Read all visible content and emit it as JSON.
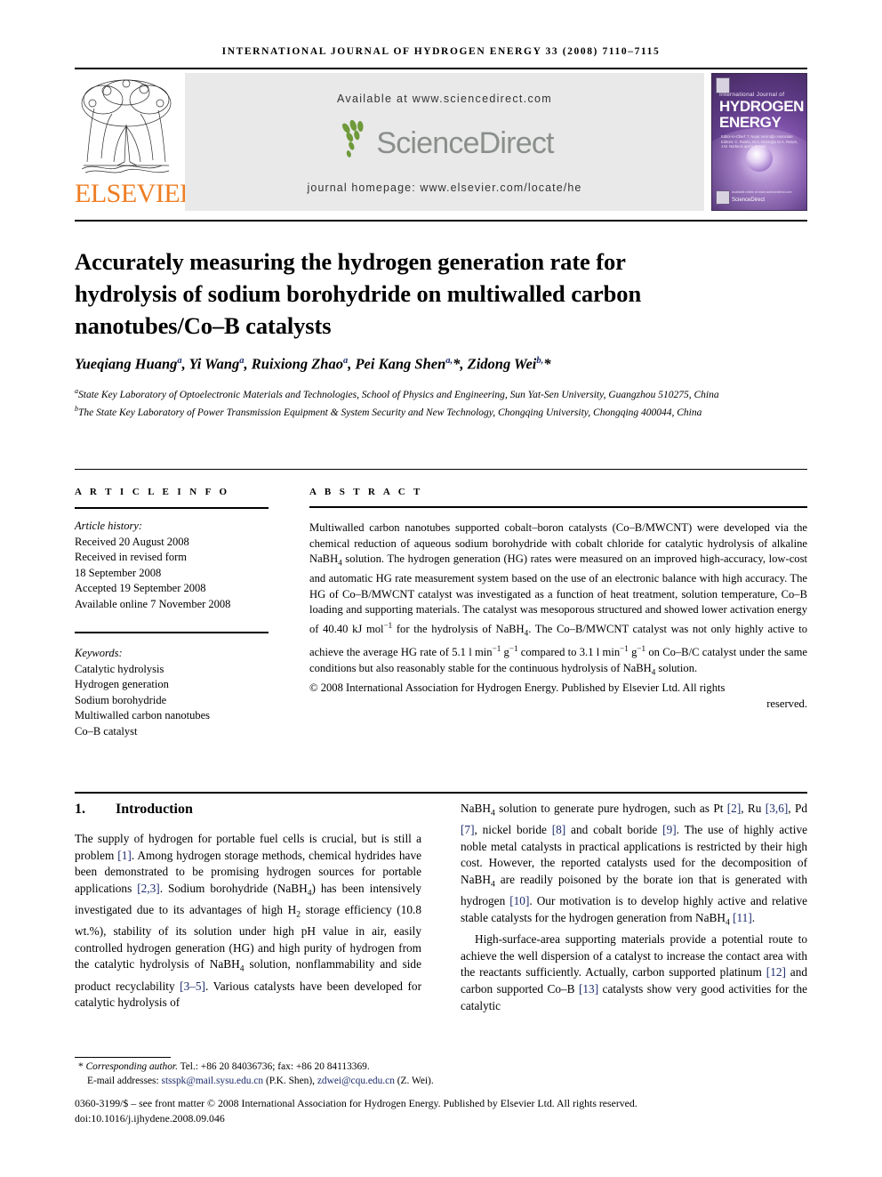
{
  "running_head": "INTERNATIONAL JOURNAL OF HYDROGEN ENERGY 33 (2008) 7110–7115",
  "masthead": {
    "publisher": "ELSEVIER",
    "available_at": "Available at www.sciencedirect.com",
    "sciencedirect_word": "ScienceDirect",
    "journal_homepage": "journal homepage: www.elsevier.com/locate/he",
    "cover": {
      "line1": "International Journal of",
      "line2": "HYDROGEN",
      "line3": "ENERGY",
      "editors": "Editor-in-Chief: T. Nejat Veziroğlu\nAssociate Editors: C. Rosén, M.A. Veziroğlu\nM.A. Rosen, J.M. Norbeck\nand E.E. Unit",
      "sciencedirect_badge": "ScienceDirect",
      "sciencedirect_badge_sup": "Available online at www.sciencedirect.com"
    }
  },
  "title": "Accurately measuring the hydrogen generation rate for hydrolysis of sodium borohydride on multiwalled carbon nanotubes/Co–B catalysts",
  "authors_html": "Yueqiang Huang<sup>a</sup>, Yi Wang<sup>a</sup>, Ruixiong Zhao<sup>a</sup>, Pei Kang Shen<sup>a,</sup>*, Zidong Wei<sup>b,</sup>*",
  "affiliations_html": "<sup>a</sup>State Key Laboratory of Optoelectronic Materials and Technologies, School of Physics and Engineering, Sun Yat-Sen University, Guangzhou 510275, China<br><sup>b</sup>The State Key Laboratory of Power Transmission Equipment &amp; System Security and New Technology, Chongqing University, Chongqing 400044, China",
  "article_info": {
    "heading": "A R T I C L E   I N F O",
    "history_label": "Article history:",
    "history": [
      "Received 20 August 2008",
      "Received in revised form",
      "18 September 2008",
      "Accepted 19 September 2008",
      "Available online 7 November 2008"
    ],
    "keywords_label": "Keywords:",
    "keywords": [
      "Catalytic hydrolysis",
      "Hydrogen generation",
      "Sodium borohydride",
      "Multiwalled carbon nanotubes",
      "Co–B catalyst"
    ]
  },
  "abstract": {
    "heading": "A B S T R A C T",
    "body_html": "Multiwalled carbon nanotubes supported cobalt–boron catalysts (Co–B/MWCNT) were developed via the chemical reduction of aqueous sodium borohydride with cobalt chloride for catalytic hydrolysis of alkaline NaBH<sub>4</sub> solution. The hydrogen generation (HG) rates were measured on an improved high-accuracy, low-cost and automatic HG rate measurement system based on the use of an electronic balance with high accuracy. The HG of Co–B/MWCNT catalyst was investigated as a function of heat treatment, solution temperature, Co–B loading and supporting materials. The catalyst was mesoporous structured and showed lower activation energy of 40.40 kJ mol<sup>−1</sup> for the hydrolysis of NaBH<sub>4</sub>. The Co–B/MWCNT catalyst was not only highly active to achieve the average HG rate of 5.1 l min<sup>−1</sup> g<sup>−1</sup> compared to 3.1 l min<sup>−1</sup> g<sup>−1</sup> on Co–B/C catalyst under the same conditions but also reasonably stable for the continuous hydrolysis of NaBH<sub>4</sub> solution.",
    "copyright_html": "© 2008 International Association for Hydrogen Energy. Published by Elsevier Ltd. All rights<span class=\"right-end\">reserved.</span>"
  },
  "introduction": {
    "number": "1.",
    "heading": "Introduction",
    "left_paragraphs_html": [
      "The supply of hydrogen for portable fuel cells is crucial, but is still a problem <span class=\"ref\">[1]</span>. Among hydrogen storage methods, chemical hydrides have been demonstrated to be promising hydrogen sources for portable applications <span class=\"ref\">[2,3]</span>. Sodium borohydride (NaBH<sub>4</sub>) has been intensively investigated due to its advantages of high H<sub>2</sub> storage efficiency (10.8 wt.%), stability of its solution under high pH value in air, easily controlled hydrogen generation (HG) and high purity of hydrogen from the catalytic hydrolysis of NaBH<sub>4</sub> solution, nonflammability and side product recyclability <span class=\"ref\">[3–5]</span>. Various catalysts have been developed for catalytic hydrolysis of"
    ],
    "right_paragraphs_html": [
      "NaBH<sub>4</sub> solution to generate pure hydrogen, such as Pt <span class=\"ref\">[2]</span>, Ru <span class=\"ref\">[3,6]</span>, Pd <span class=\"ref\">[7]</span>, nickel boride <span class=\"ref\">[8]</span> and cobalt boride <span class=\"ref\">[9]</span>. The use of highly active noble metal catalysts in practical applications is restricted by their high cost. However, the reported catalysts used for the decomposition of NaBH<sub>4</sub> are readily poisoned by the borate ion that is generated with hydrogen <span class=\"ref\">[10]</span>. Our motivation is to develop highly active and relative stable catalysts for the hydrogen generation from NaBH<sub>4</sub> <span class=\"ref\">[11]</span>.",
      "High-surface-area supporting materials provide a potential route to achieve the well dispersion of a catalyst to increase the contact area with the reactants sufficiently. Actually, carbon supported platinum <span class=\"ref\">[12]</span> and carbon supported Co–B <span class=\"ref\">[13]</span> catalysts show very good activities for the catalytic"
    ]
  },
  "footnotes": {
    "corresponding_html": "* <i>Corresponding author.</i> Tel.: +86 20 84036736; fax: +86 20 84113369.",
    "emails_html": "E-mail addresses: <span class=\"email\">stsspk@mail.sysu.edu.cn</span> (P.K. Shen), <span class=\"email\">zdwei@cqu.edu.cn</span> (Z. Wei).",
    "issn_line": "0360-3199/$ – see front matter © 2008 International Association for Hydrogen Energy. Published by Elsevier Ltd. All rights reserved.",
    "doi_line": "doi:10.1016/j.ijhydene.2008.09.046"
  },
  "colors": {
    "elsevier_orange": "#ef7d22",
    "sciencedirect_gray": "#8b8f8b",
    "sciencedirect_green": "#6f9a3a",
    "link_navy": "#1b2a6b",
    "band_gray": "#e9e9e9"
  }
}
